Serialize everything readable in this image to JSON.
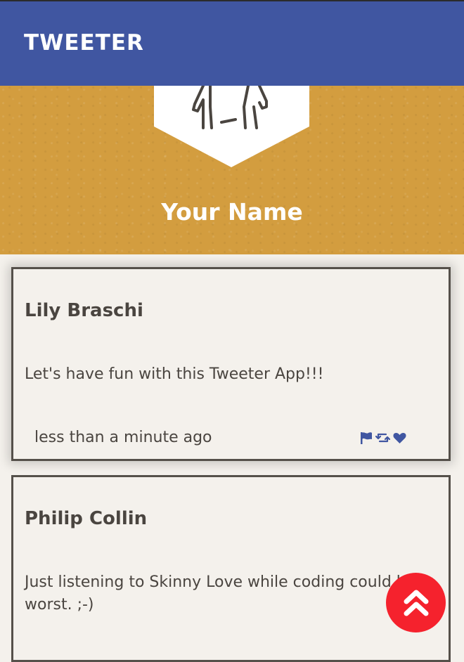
{
  "navbar": {
    "brand": "Tweeter",
    "color": "#4056a1"
  },
  "profile": {
    "name": "Your Name",
    "background_color": "#d39d3f",
    "avatar_icon": "person-avatar-icon"
  },
  "tweets": [
    {
      "author": "Lily Braschi",
      "content": "Let's have fun with this Tweeter App!!!",
      "timestamp": "less than a minute ago",
      "actions": [
        "flag-icon",
        "retweet-icon",
        "heart-icon"
      ]
    },
    {
      "author": "Philip Collin",
      "content": "Just listening to Skinny Love while coding could be worst. ;-)"
    }
  ],
  "scroll_button": {
    "icon": "double-chevron-up-icon",
    "color": "#f5222d"
  }
}
